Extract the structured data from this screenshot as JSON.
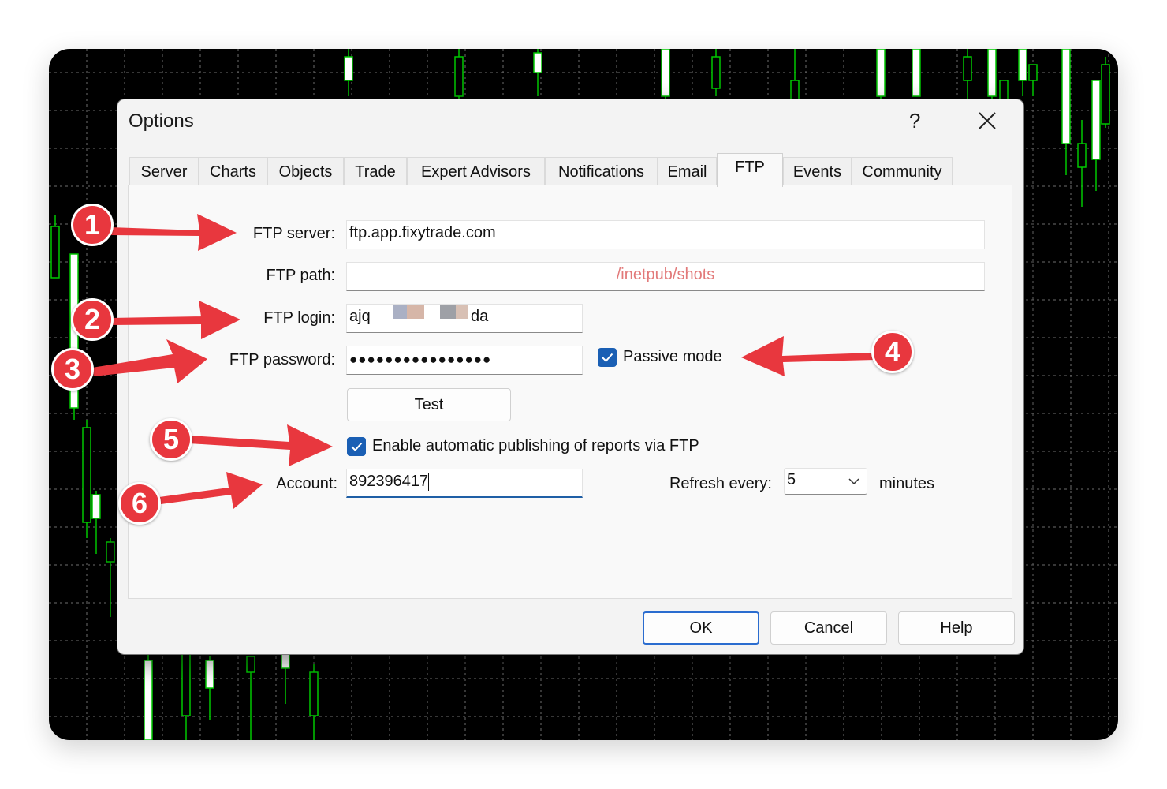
{
  "dialog": {
    "title": "Options",
    "help_label": "?",
    "close_icon": "close-icon"
  },
  "tabs": [
    {
      "label": "Server"
    },
    {
      "label": "Charts"
    },
    {
      "label": "Objects"
    },
    {
      "label": "Trade"
    },
    {
      "label": "Expert Advisors"
    },
    {
      "label": "Notifications"
    },
    {
      "label": "Email"
    },
    {
      "label": "FTP",
      "active": true
    },
    {
      "label": "Events"
    },
    {
      "label": "Community"
    }
  ],
  "ftp": {
    "server_label": "FTP server:",
    "server_value": "ftp.app.fixytrade.com",
    "path_label": "FTP path:",
    "path_value": "/inetpub/shots",
    "login_label": "FTP login:",
    "login_value_start": "ajq",
    "login_value_end": "da",
    "password_label": "FTP password:",
    "password_value": "●●●●●●●●●●●●●●●●",
    "passive_label": "Passive mode",
    "passive_checked": true,
    "test_label": "Test",
    "enable_label": "Enable automatic publishing of reports via FTP",
    "enable_checked": true,
    "account_label": "Account:",
    "account_value": "892396417",
    "refresh_label": "Refresh every:",
    "refresh_value": "5",
    "minutes_label": "minutes"
  },
  "buttons": {
    "ok": "OK",
    "cancel": "Cancel",
    "help": "Help"
  },
  "annotations": [
    "1",
    "2",
    "3",
    "4",
    "5",
    "6"
  ],
  "colors": {
    "annotation": "#e8373e",
    "chart_background": "#000000",
    "candle_green": "#00c800",
    "accent": "#1a5fb4"
  }
}
